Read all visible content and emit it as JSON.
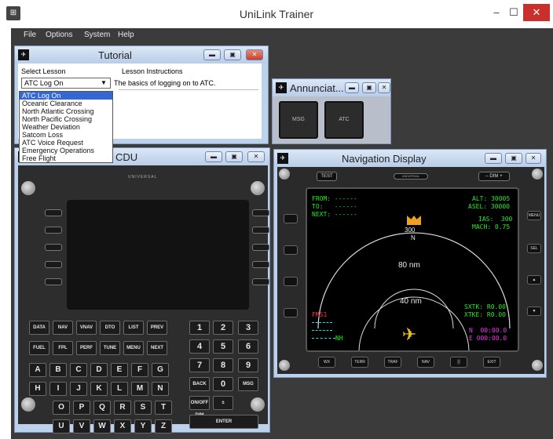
{
  "app": {
    "title": "UniLink Trainer",
    "icon": "app-icon",
    "minimize": "–",
    "maximize": "☐",
    "close": "✕"
  },
  "menu": [
    "File",
    "Options",
    "System",
    "Help"
  ],
  "tutorial": {
    "title": "Tutorial",
    "select_label": "Select Lesson",
    "instructions_label": "Lesson Instructions",
    "selected_lesson": "ATC Log On",
    "instructions": "The basics of logging on to ATC.",
    "lessons": [
      "ATC Log On",
      "Oceanic Clearance",
      "North Atlantic Crossing",
      "North Pacific Crossing",
      "Weather Deviation",
      "Satcom Loss",
      "ATC Voice Request",
      "Emergency Operations",
      "Free Flight"
    ]
  },
  "annunciator": {
    "title": "Annunciat...",
    "buttons": [
      "MSG",
      "ATC"
    ]
  },
  "cdu": {
    "title": "CDU",
    "brand": "UNIVERSAL",
    "function_keys": [
      "DATA",
      "NAV",
      "VNAV",
      "DTO",
      "LIST",
      "PREV",
      "FUEL",
      "FPL",
      "PERF",
      "TUNE",
      "MENU",
      "NEXT"
    ],
    "alpha_keys": [
      "A",
      "B",
      "C",
      "D",
      "E",
      "F",
      "G",
      "H",
      "I",
      "J",
      "K",
      "L",
      "M",
      "N",
      "O",
      "P",
      "Q",
      "R",
      "S",
      "T",
      "U",
      "V",
      "W",
      "X",
      "Y",
      "Z"
    ],
    "num_keys": [
      "1",
      "2",
      "3",
      "4",
      "5",
      "6",
      "7",
      "8",
      "9",
      "BACK",
      "0",
      "MSG",
      "ON/OFF DIM",
      "±",
      "ENTER"
    ]
  },
  "nav": {
    "title": "Navigation Display",
    "brand": "UNIVERSAL",
    "test_label": "TEST",
    "dim_label": "– DIM +",
    "left_top": [
      "FROM: ------",
      "TO:   ------",
      "NEXT: ------"
    ],
    "alt": "ALT: 30005",
    "asel": "ASEL: 30000",
    "ias": "IAS:  300",
    "mach": "MACH: 0.75",
    "heading": "300",
    "heading_letter": "N",
    "range_outer": "80 nm",
    "range_inner": "40 nm",
    "fms": "FMS1",
    "nh": "NH",
    "sxtk": "SXTK: R0.00",
    "xtke": "XTKE: R0.00",
    "north": "N  00:00.0",
    "east": "E 000:00.0",
    "right_keys": [
      "MENU",
      "SEL"
    ],
    "bottom_keys": [
      "WX",
      "TERR",
      "TRAF",
      "NAV",
      "▒",
      "EXIT"
    ],
    "colors": {
      "green": "#27e827",
      "cyan": "#2ad8e8",
      "magenta": "#e83be8",
      "heading_marker": "#f0a020"
    }
  }
}
